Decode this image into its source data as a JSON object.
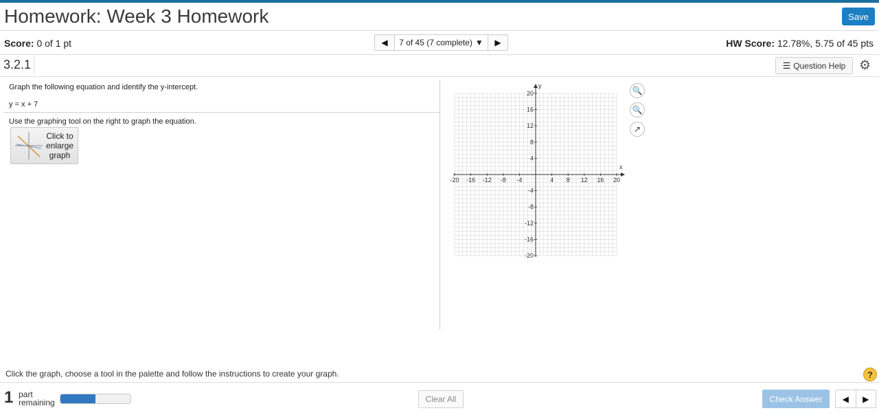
{
  "header": {
    "title": "Homework: Week 3 Homework",
    "save_label": "Save",
    "accent_color": "#1c7ec3"
  },
  "scorebar": {
    "score_label": "Score:",
    "score_value": "0 of 1 pt",
    "nav_position": "7 of 45 (7 complete)",
    "hw_score_label": "HW Score:",
    "hw_score_value": "12.78%, 5.75 of 45 pts"
  },
  "question": {
    "number": "3.2.1",
    "help_label": "Question Help",
    "instruction": "Graph the following equation and identify the y-intercept.",
    "equation": "y = x + 7",
    "tool_instruction": "Use the graphing tool on the right to graph the equation.",
    "enlarge_label": [
      "Click to",
      "enlarge",
      "graph"
    ]
  },
  "graph": {
    "x_axis_label": "x",
    "y_axis_label": "y",
    "x_range": [
      -20,
      20
    ],
    "y_range": [
      -20,
      20
    ],
    "grid_step": 1,
    "x_tick_labels": [
      "-20",
      "-16",
      "-12",
      "-8",
      "-4",
      "4",
      "8",
      "12",
      "16",
      "20"
    ],
    "y_tick_labels": [
      "20",
      "16",
      "12",
      "8",
      "4",
      "-4",
      "-8",
      "-12",
      "-16",
      "-20"
    ],
    "tools": [
      "zoom-in-icon",
      "zoom-out-icon",
      "external-link-icon"
    ]
  },
  "footer": {
    "instruction": "Click the graph, choose a tool in the palette and follow the instructions to create your graph.",
    "parts_remaining_count": "1",
    "parts_remaining_word1": "part",
    "parts_remaining_word2": "remaining",
    "progress_fraction": 0.5,
    "clear_all_label": "Clear All",
    "check_answer_label": "Check Answer"
  }
}
